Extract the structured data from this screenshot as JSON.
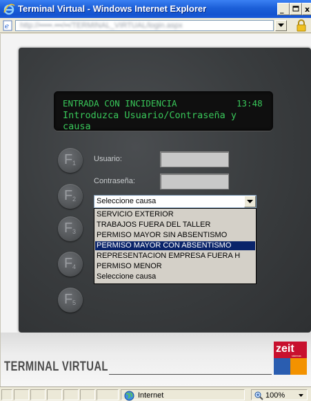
{
  "window": {
    "title": "Terminal Virtual - Windows Internet Explorer",
    "address": "http://•••••.•••/••/TERMINAL_VIRTUAL/login.aspx"
  },
  "lcd": {
    "line1": "ENTRADA CON INCIDENCIA",
    "time": "13:48",
    "line2": "Introduzca Usuario/Contraseña y",
    "line3": "causa"
  },
  "fkeys": [
    {
      "letter": "F",
      "num": "1"
    },
    {
      "letter": "F",
      "num": "2"
    },
    {
      "letter": "F",
      "num": "3"
    },
    {
      "letter": "F",
      "num": "4"
    },
    {
      "letter": "F",
      "num": "5"
    }
  ],
  "form": {
    "usuario_label": "Usuario:",
    "contrasena_label": "Contraseña:",
    "usuario_value": "",
    "contrasena_value": "",
    "causa_selected": "Seleccione causa"
  },
  "causa_options": [
    "SERVICIO EXTERIOR",
    "TRABAJOS FUERA DEL TALLER",
    "PERMISO MAYOR SIN ABSENTISMO",
    "PERMISO MAYOR CON ABSENTISMO",
    "REPRESENTACION EMPRESA FUERA H",
    "PERMISO MENOR",
    "Seleccione causa"
  ],
  "highlighted_option": "PERMISO MAYOR CON ABSENTISMO",
  "branding": {
    "terminal_label": "TERMINAL VIRTUAL",
    "logo_text": "zeit",
    "logo_sub": "sistemas",
    "colors": {
      "red": "#c8102e",
      "blue": "#2a5db0",
      "orange": "#f39200"
    }
  },
  "statusbar": {
    "zone": "Internet",
    "zoom": "100%"
  },
  "icons": [
    "ie-icon",
    "page-icon",
    "lock-icon",
    "globe-icon",
    "zoom-icon"
  ]
}
